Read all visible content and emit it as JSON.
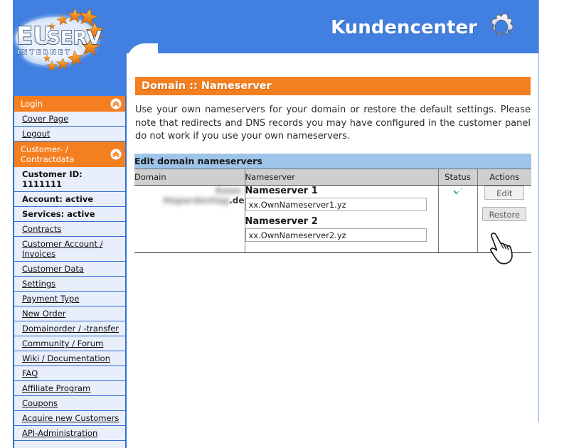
{
  "header": {
    "brand_title": "Kundencenter",
    "gear_icon": "gear-icon",
    "logo_text_primary": "EU",
    "logo_text_secondary": "SERV",
    "logo_subtitle": "I N T E R N E T",
    "brand_blue": "#4180e0",
    "accent_orange": "#f47f20"
  },
  "section": {
    "title": "Domain :: Nameserver",
    "intro": "Use your own nameservers for your domain or restore the default settings. Please note that redirects and DNS records you may have configured in the customer panel do not work if you use your own nameservers."
  },
  "table": {
    "caption": "Edit domain nameservers",
    "columns": [
      "Domain",
      "Nameserver",
      "Status",
      "Actions"
    ],
    "rows": [
      {
        "domain_redacted": "Kaae. Hapardentag",
        "domain_suffix": ".de",
        "nameservers": [
          {
            "label": "Nameserver 1",
            "value": "xx.OwnNameserver1.yz"
          },
          {
            "label": "Nameserver 2",
            "value": "xx.OwnNameserver2.yz"
          }
        ],
        "status_icon": "green-check-icon",
        "status_color": "#2fa34b",
        "actions": [
          {
            "label": "Edit",
            "name": "edit-button"
          },
          {
            "label": "Restore",
            "name": "restore-button"
          }
        ]
      }
    ]
  },
  "cursor": {
    "icon": "pointing-hand-cursor"
  },
  "sidebar": {
    "groups": [
      {
        "title": "Login",
        "collapse_icon": "double-chevron-up-icon",
        "items": [
          {
            "label": "Cover Page",
            "type": "link"
          },
          {
            "label": "Logout",
            "type": "link"
          }
        ]
      },
      {
        "title": "Customer- / Contractdata",
        "collapse_icon": "double-chevron-up-icon",
        "items": [
          {
            "label": "Customer ID: 1111111",
            "type": "info"
          },
          {
            "label": "Account: active",
            "type": "info"
          },
          {
            "label": "Services: active",
            "type": "info"
          },
          {
            "label": "Contracts",
            "type": "link"
          },
          {
            "label": "Customer Account / Invoices",
            "type": "link"
          },
          {
            "label": "Customer Data",
            "type": "link"
          },
          {
            "label": "Settings",
            "type": "link"
          },
          {
            "label": "Payment Type",
            "type": "link"
          },
          {
            "label": "New Order",
            "type": "link"
          },
          {
            "label": "Domainorder / -transfer",
            "type": "link"
          },
          {
            "label": "Community / Forum",
            "type": "link"
          },
          {
            "label": "Wiki / Documentation",
            "type": "link"
          },
          {
            "label": "FAQ",
            "type": "link"
          },
          {
            "label": "Affiliate Program",
            "type": "link"
          },
          {
            "label": "Coupons",
            "type": "link"
          },
          {
            "label": "Acquire new Customers",
            "type": "link"
          },
          {
            "label": "API-Administration",
            "type": "link"
          }
        ]
      }
    ]
  }
}
